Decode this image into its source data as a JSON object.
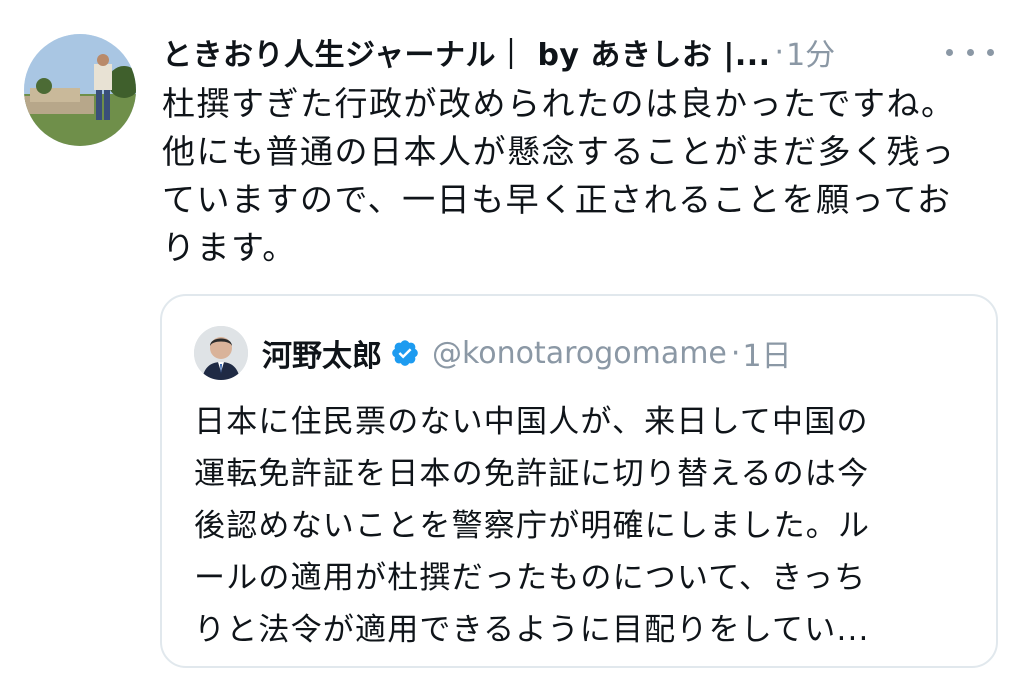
{
  "tweet": {
    "author_display": "ときおり人生ジャーナル｜ by あきしお |...",
    "separator": "·",
    "time": "1分",
    "more_icon": "more-horizontal-icon",
    "text": "杜撰すぎた行政が改められたのは良かったですね。\n他にも普通の日本人が懸念することがまだ多く残っ\nていますので、一日も早く正されることを願ってお\nります。"
  },
  "quote": {
    "name": "河野太郎",
    "verified_icon": "verified-badge-icon",
    "handle": "@konotarogomame",
    "separator": "·",
    "time": "1日",
    "text": "日本に住民票のない中国人が、来日して中国の\n運転免許証を日本の免許証に切り替えるのは今\n後認めないことを警察庁が明確にしました。ル\nールの適用が杜撰だったものについて、きっち\nりと法令が適用できるように目配りをしてい..."
  },
  "colors": {
    "text_primary": "#0f1419",
    "text_secondary": "#8b98a5",
    "verified_blue": "#1d9bf0",
    "card_border": "#e1e8ed"
  }
}
